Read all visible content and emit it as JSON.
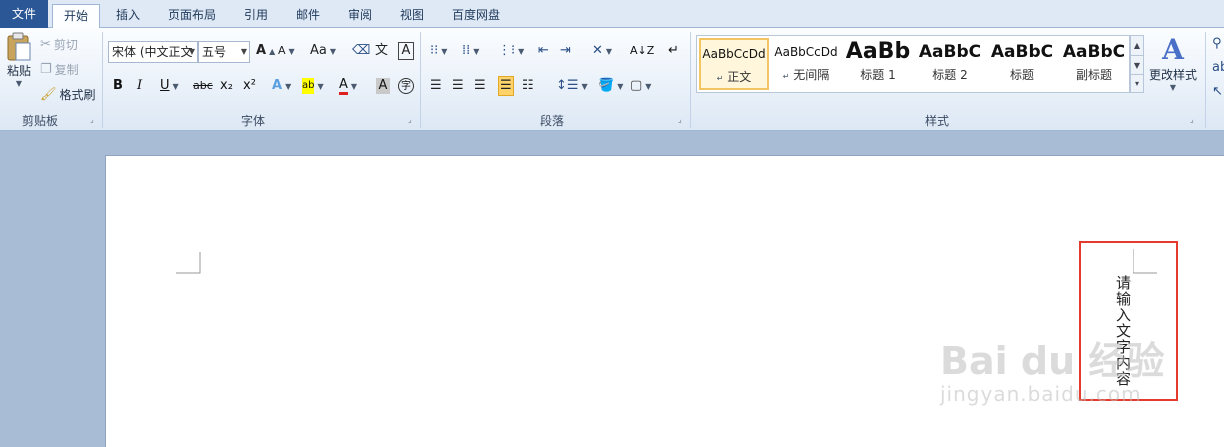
{
  "tabs": [
    "文件",
    "开始",
    "插入",
    "页面布局",
    "引用",
    "邮件",
    "审阅",
    "视图",
    "百度网盘"
  ],
  "clipboard": {
    "paste": "粘贴",
    "cut": "剪切",
    "copy": "复制",
    "format_painter": "格式刷",
    "label": "剪贴板"
  },
  "font": {
    "name": "宋体 (中文正文",
    "size": "五号",
    "label": "字体",
    "grow": "A",
    "shrink": "A",
    "case": "Aa",
    "clear": "A"
  },
  "paragraph": {
    "label": "段落"
  },
  "styles": {
    "label": "样式",
    "change_styles": "更改样式",
    "items": [
      {
        "sample": "AaBbCcDd",
        "name": "正文"
      },
      {
        "sample": "AaBbCcDd",
        "name": "无间隔"
      },
      {
        "sample": "AaBb",
        "name": "标题 1"
      },
      {
        "sample": "AaBbC",
        "name": "标题 2"
      },
      {
        "sample": "AaBbC",
        "name": "标题"
      },
      {
        "sample": "AaBbC",
        "name": "副标题"
      }
    ]
  },
  "document": {
    "textbox_text": "请输入文字内容"
  },
  "watermark": {
    "line1": "Bai du 经验",
    "line2": "jingyan.baidu.com"
  },
  "colors": {
    "file_tab": "#2b5797",
    "highlight_box": "#e53b2e",
    "selected_style": "#f2c462"
  }
}
